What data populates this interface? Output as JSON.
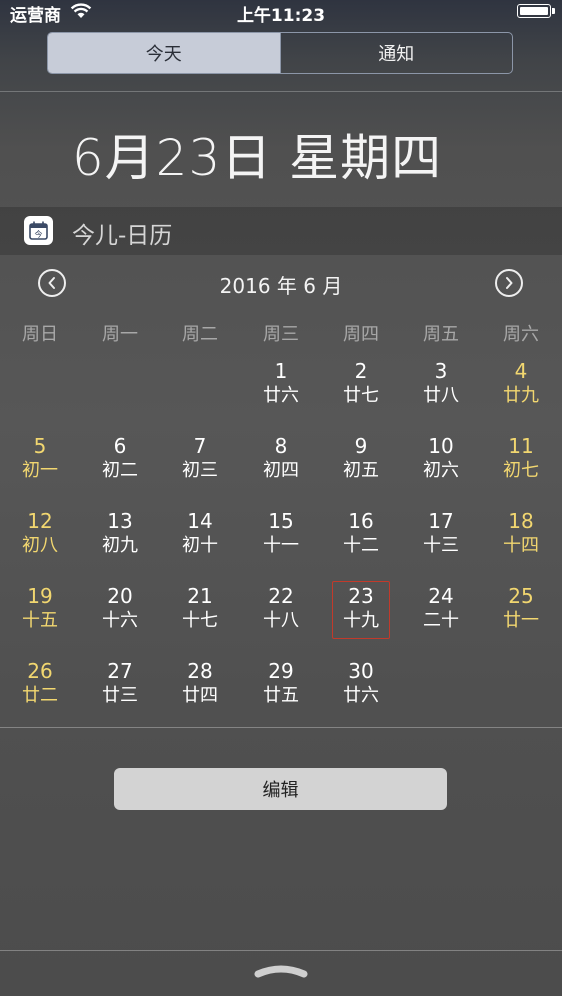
{
  "status_bar": {
    "carrier": "运营商",
    "time": "上午11:23"
  },
  "segments": {
    "today": "今天",
    "notifications": "通知",
    "selected": "今天"
  },
  "date_heading": "6月23日 星期四",
  "widget": {
    "icon_text": "今",
    "title": "今儿-日历"
  },
  "calendar": {
    "month_label": "2016 年 6 月",
    "weekdays": [
      "周日",
      "周一",
      "周二",
      "周三",
      "周四",
      "周五",
      "周六"
    ],
    "first_weekday_index": 3,
    "today": 23,
    "days": [
      {
        "day": "1",
        "lunar": "廿六"
      },
      {
        "day": "2",
        "lunar": "廿七"
      },
      {
        "day": "3",
        "lunar": "廿八"
      },
      {
        "day": "4",
        "lunar": "廿九"
      },
      {
        "day": "5",
        "lunar": "初一"
      },
      {
        "day": "6",
        "lunar": "初二"
      },
      {
        "day": "7",
        "lunar": "初三"
      },
      {
        "day": "8",
        "lunar": "初四"
      },
      {
        "day": "9",
        "lunar": "初五"
      },
      {
        "day": "10",
        "lunar": "初六"
      },
      {
        "day": "11",
        "lunar": "初七"
      },
      {
        "day": "12",
        "lunar": "初八"
      },
      {
        "day": "13",
        "lunar": "初九"
      },
      {
        "day": "14",
        "lunar": "初十"
      },
      {
        "day": "15",
        "lunar": "十一"
      },
      {
        "day": "16",
        "lunar": "十二"
      },
      {
        "day": "17",
        "lunar": "十三"
      },
      {
        "day": "18",
        "lunar": "十四"
      },
      {
        "day": "19",
        "lunar": "十五"
      },
      {
        "day": "20",
        "lunar": "十六"
      },
      {
        "day": "21",
        "lunar": "十七"
      },
      {
        "day": "22",
        "lunar": "十八"
      },
      {
        "day": "23",
        "lunar": "十九"
      },
      {
        "day": "24",
        "lunar": "二十"
      },
      {
        "day": "25",
        "lunar": "廿一"
      },
      {
        "day": "26",
        "lunar": "廿二"
      },
      {
        "day": "27",
        "lunar": "廿三"
      },
      {
        "day": "28",
        "lunar": "廿四"
      },
      {
        "day": "29",
        "lunar": "廿五"
      },
      {
        "day": "30",
        "lunar": "廿六"
      }
    ]
  },
  "edit_label": "编辑",
  "colors": {
    "weekend": "#f2d770",
    "today_border": "#c23a2b",
    "segment_active_bg": "#c7ccd8"
  },
  "icons": [
    "wifi-icon",
    "battery-icon",
    "calendar-app-icon",
    "chevron-left-icon",
    "chevron-right-icon",
    "grabber-icon"
  ]
}
